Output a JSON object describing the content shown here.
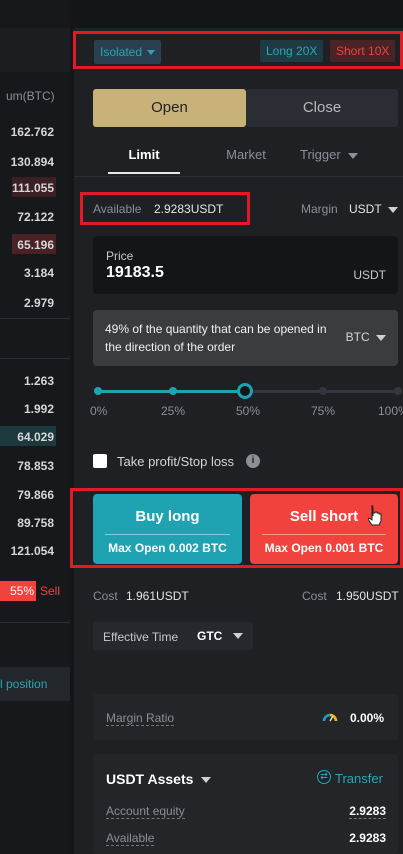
{
  "orderbook": {
    "header": "um(BTC)",
    "rows": [
      "162.762",
      "130.894",
      "111.055",
      "72.122",
      "65.196",
      "3.184",
      "2.979",
      "1.263",
      "1.992",
      "64.029",
      "78.853",
      "79.866",
      "89.758",
      "121.054"
    ],
    "badge_pct": "55%",
    "sell_label": "Sell",
    "position_label": "l position"
  },
  "margin_mode": "Isolated",
  "long_lev": "Long 20X",
  "short_lev": "Short 10X",
  "tabs": {
    "open": "Open",
    "close": "Close"
  },
  "order_types": {
    "limit": "Limit",
    "market": "Market",
    "trigger": "Trigger"
  },
  "available": {
    "label": "Available",
    "value": "2.9283USDT"
  },
  "margin": {
    "label": "Margin",
    "value": "USDT"
  },
  "price": {
    "label": "Price",
    "value": "19183.5",
    "unit": "USDT"
  },
  "quantity": {
    "text": "49% of the quantity that can be opened in the direction of the order",
    "unit": "BTC",
    "percent": 49
  },
  "slider": {
    "ticks": [
      "0%",
      "25%",
      "50%",
      "75%",
      "100%"
    ],
    "value_pct": 49
  },
  "tpsl": {
    "label": "Take profit/Stop loss"
  },
  "buy": {
    "title": "Buy long",
    "sub": "Max Open 0.002 BTC"
  },
  "sell": {
    "title": "Sell short",
    "sub": "Max Open 0.001 BTC"
  },
  "cost": {
    "label": "Cost",
    "buy_value": "1.961USDT",
    "sell_value": "1.950USDT"
  },
  "effective_time": {
    "label": "Effective Time",
    "value": "GTC"
  },
  "margin_ratio": {
    "label": "Margin Ratio",
    "value": "0.00%"
  },
  "assets": {
    "title": "USDT Assets",
    "transfer": "Transfer",
    "equity_label": "Account equity",
    "equity_value": "2.9283",
    "available_label": "Available",
    "available_value": "2.9283"
  },
  "colors": {
    "teal": "#1fa3b3",
    "red": "#f2423e",
    "gold": "#c8b27a",
    "highlight": "#e01b24"
  }
}
